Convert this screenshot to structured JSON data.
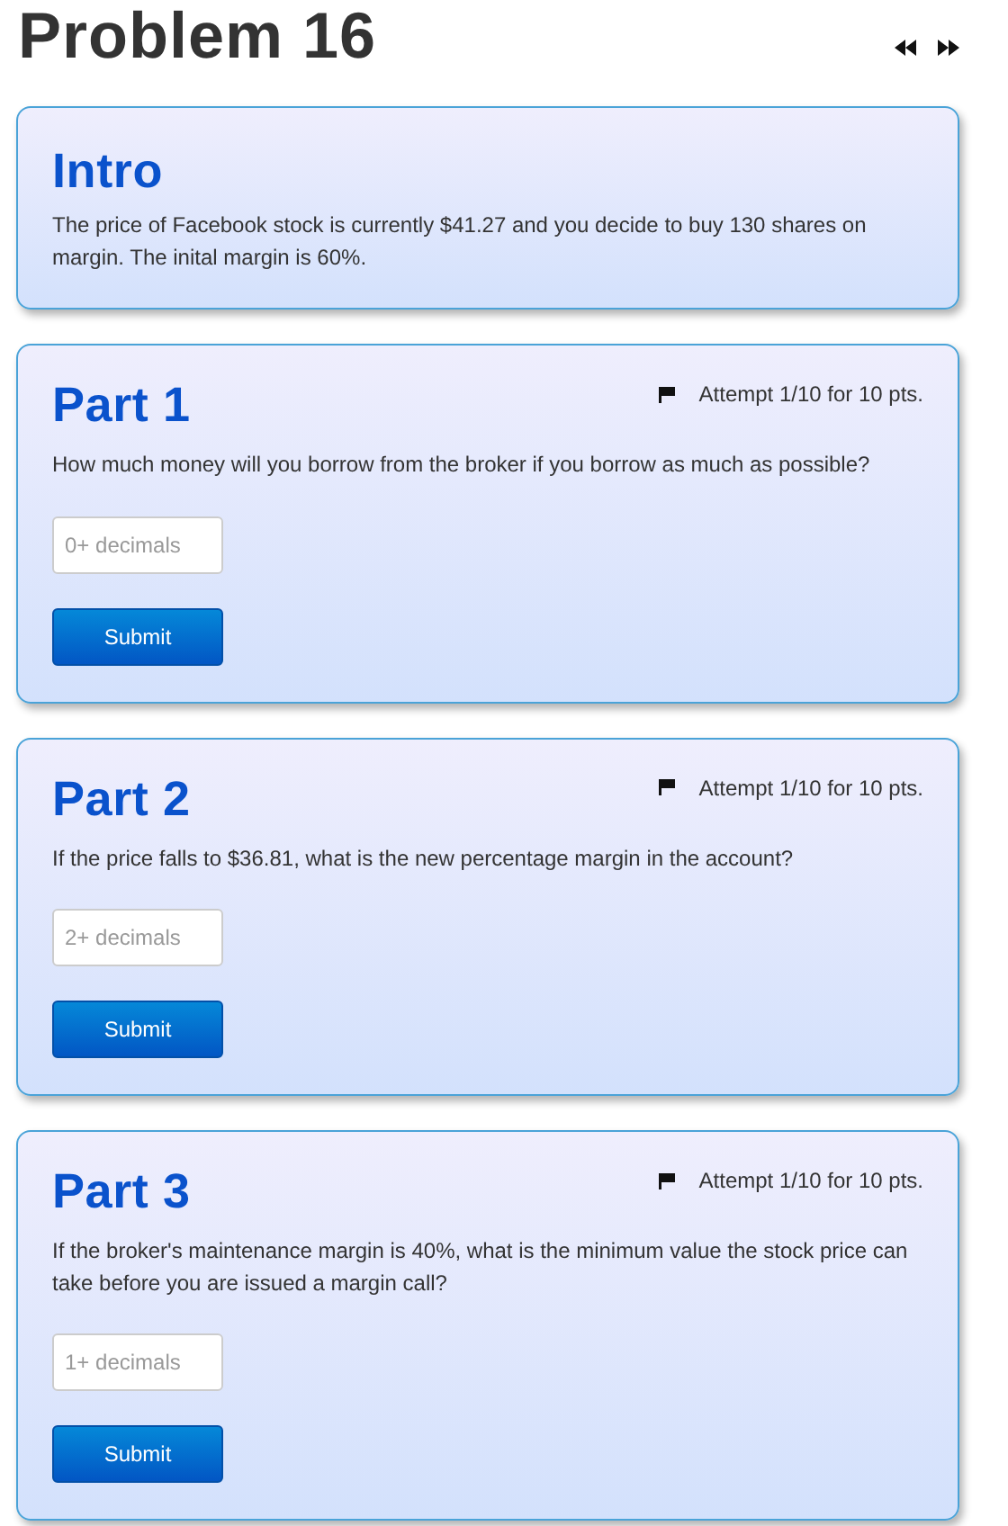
{
  "title": "Problem 16",
  "intro": {
    "heading": "Intro",
    "text": "The price of Facebook stock is currently $41.27 and you decide to buy 130 shares on margin. The inital margin is 60%."
  },
  "parts": [
    {
      "heading": "Part 1",
      "attempt": "Attempt 1/10 for 10 pts.",
      "question": "How much money will you borrow from the broker if you borrow as much as possible?",
      "placeholder": "0+ decimals",
      "button": "Submit"
    },
    {
      "heading": "Part 2",
      "attempt": "Attempt 1/10 for 10 pts.",
      "question": "If the price falls to $36.81, what is the new percentage margin in the account?",
      "placeholder": "2+ decimals",
      "button": "Submit"
    },
    {
      "heading": "Part 3",
      "attempt": "Attempt 1/10 for 10 pts.",
      "question": "If the broker's maintenance margin is 40%, what is the minimum value the stock price can take before you are issued a margin call?",
      "placeholder": "1+ decimals",
      "button": "Submit"
    }
  ]
}
